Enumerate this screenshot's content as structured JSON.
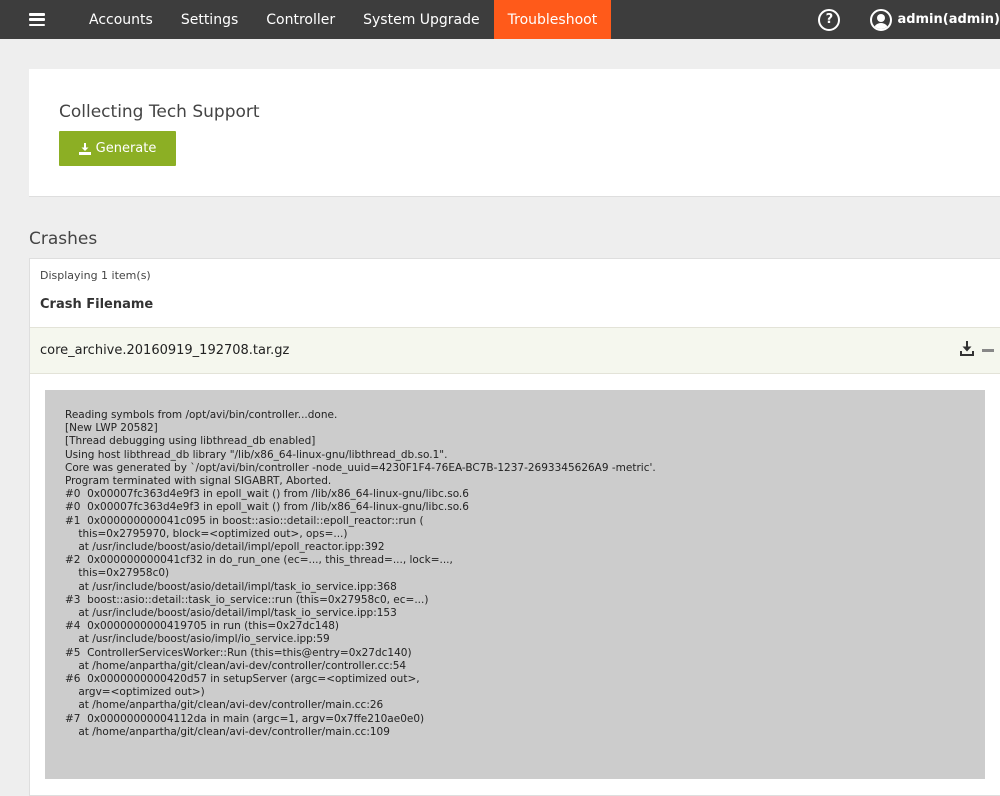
{
  "nav": {
    "items": [
      {
        "label": "Accounts"
      },
      {
        "label": "Settings"
      },
      {
        "label": "Controller"
      },
      {
        "label": "System Upgrade"
      },
      {
        "label": "Troubleshoot",
        "active": true
      }
    ],
    "help_glyph": "?",
    "user_label": "admin(admin)"
  },
  "tech_support": {
    "title": "Collecting Tech Support",
    "generate_label": "Generate"
  },
  "crashes": {
    "heading": "Crashes",
    "displaying": "Displaying 1 item(s)",
    "column_header": "Crash Filename",
    "rows": [
      {
        "filename": "core_archive.20160919_192708.tar.gz"
      }
    ],
    "trace": "Reading symbols from /opt/avi/bin/controller...done.\n[New LWP 20582]\n[Thread debugging using libthread_db enabled]\nUsing host libthread_db library \"/lib/x86_64-linux-gnu/libthread_db.so.1\".\nCore was generated by `/opt/avi/bin/controller -node_uuid=4230F1F4-76EA-BC7B-1237-2693345626A9 -metric'.\nProgram terminated with signal SIGABRT, Aborted.\n#0  0x00007fc363d4e9f3 in epoll_wait () from /lib/x86_64-linux-gnu/libc.so.6\n#0  0x00007fc363d4e9f3 in epoll_wait () from /lib/x86_64-linux-gnu/libc.so.6\n#1  0x000000000041c095 in boost::asio::detail::epoll_reactor::run (\n    this=0x2795970, block=<optimized out>, ops=...)\n    at /usr/include/boost/asio/detail/impl/epoll_reactor.ipp:392\n#2  0x000000000041cf32 in do_run_one (ec=..., this_thread=..., lock=...,\n    this=0x27958c0)\n    at /usr/include/boost/asio/detail/impl/task_io_service.ipp:368\n#3  boost::asio::detail::task_io_service::run (this=0x27958c0, ec=...)\n    at /usr/include/boost/asio/detail/impl/task_io_service.ipp:153\n#4  0x0000000000419705 in run (this=0x27dc148)\n    at /usr/include/boost/asio/impl/io_service.ipp:59\n#5  ControllerServicesWorker::Run (this=this@entry=0x27dc140)\n    at /home/anpartha/git/clean/avi-dev/controller/controller.cc:54\n#6  0x0000000000420d57 in setupServer (argc=<optimized out>,\n    argv=<optimized out>)\n    at /home/anpartha/git/clean/avi-dev/controller/main.cc:26\n#7  0x00000000004112da in main (argc=1, argv=0x7ffe210ae0e0)\n    at /home/anpartha/git/clean/avi-dev/controller/main.cc:109"
  },
  "icons": {
    "menu": "hamburger-menu-icon",
    "help": "help-icon",
    "user": "user-avatar-icon",
    "download": "download-icon",
    "collapse": "minus-icon"
  },
  "colors": {
    "nav_bg": "#3d3d3d",
    "active_tab": "#ff5a1a",
    "generate_button": "#8caf24",
    "trace_bg": "#cccccc"
  }
}
